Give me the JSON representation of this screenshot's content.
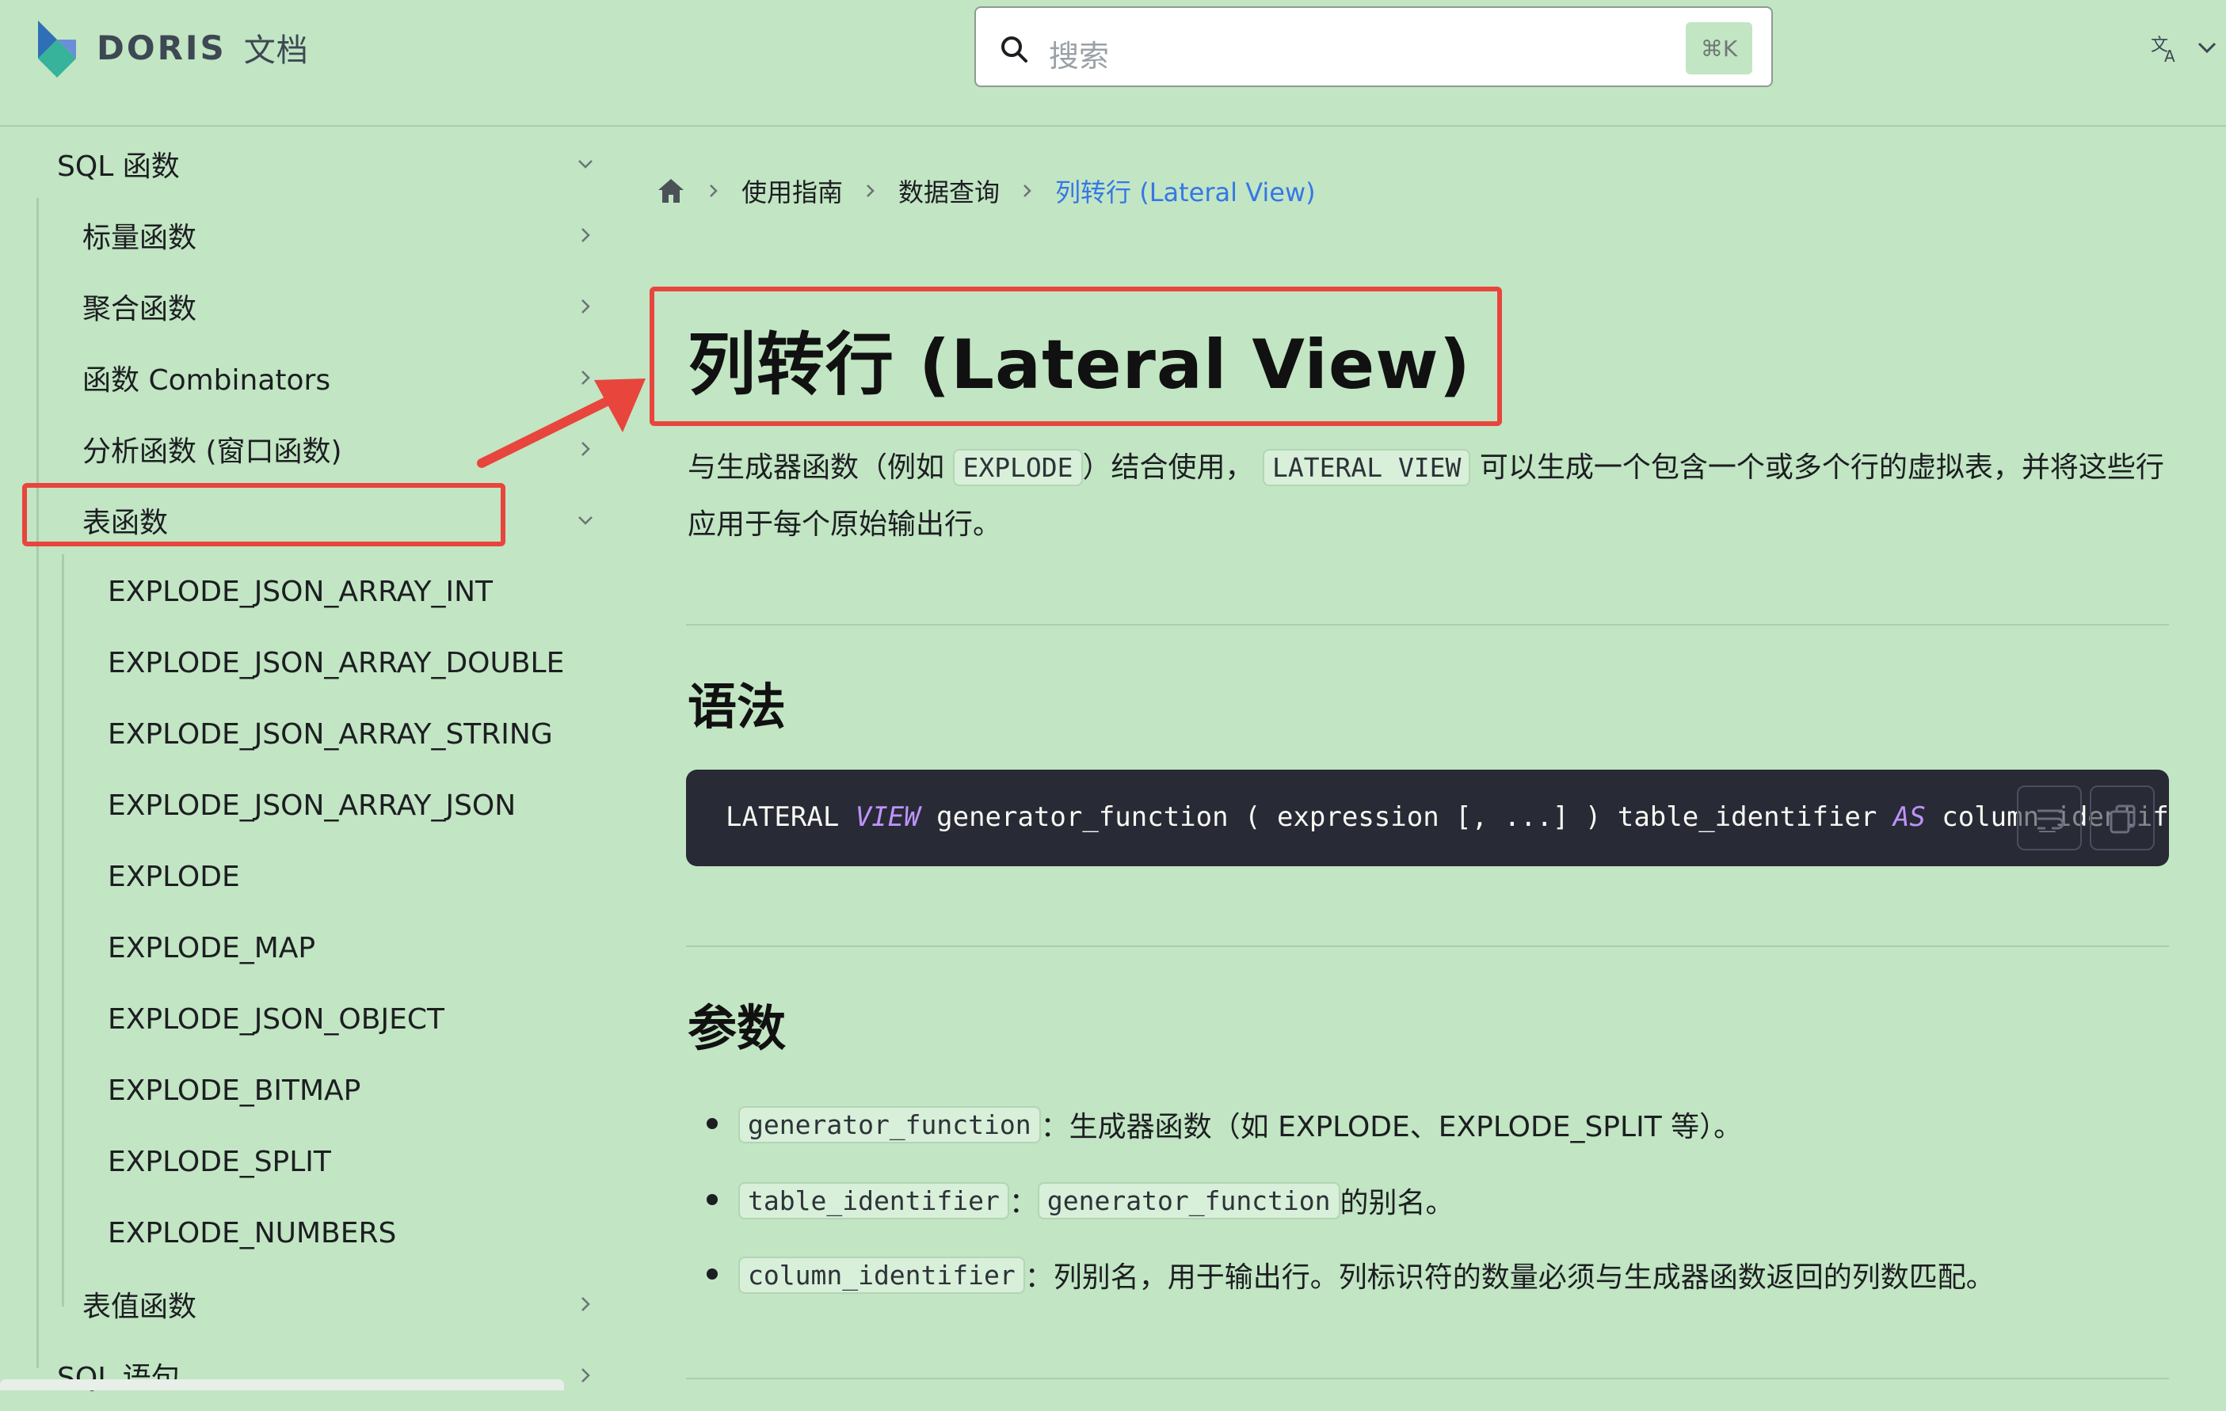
{
  "header": {
    "brand_name": "DORIS",
    "brand_suffix": "文档",
    "search": {
      "placeholder": "搜索",
      "shortcut": "⌘K"
    },
    "language_icon": "translate-icon"
  },
  "sidebar": {
    "items": [
      {
        "label": "SQL 函数",
        "chevron": "down"
      },
      {
        "label": "标量函数",
        "chevron": "right"
      },
      {
        "label": "聚合函数",
        "chevron": "right"
      },
      {
        "label": "函数 Combinators",
        "chevron": "right"
      },
      {
        "label": "分析函数 (窗口函数)",
        "chevron": "right"
      },
      {
        "label": "表函数",
        "chevron": "down"
      },
      {
        "label": "EXPLODE_JSON_ARRAY_INT"
      },
      {
        "label": "EXPLODE_JSON_ARRAY_DOUBLE"
      },
      {
        "label": "EXPLODE_JSON_ARRAY_STRING"
      },
      {
        "label": "EXPLODE_JSON_ARRAY_JSON"
      },
      {
        "label": "EXPLODE"
      },
      {
        "label": "EXPLODE_MAP"
      },
      {
        "label": "EXPLODE_JSON_OBJECT"
      },
      {
        "label": "EXPLODE_BITMAP"
      },
      {
        "label": "EXPLODE_SPLIT"
      },
      {
        "label": "EXPLODE_NUMBERS"
      },
      {
        "label": "表值函数",
        "chevron": "right"
      },
      {
        "label": "SQL 语句",
        "chevron": "right"
      }
    ]
  },
  "breadcrumb": {
    "items": [
      "使用指南",
      "数据查询",
      "列转行 (Lateral View)"
    ]
  },
  "article": {
    "title": "列转行 (Lateral View)",
    "intro": {
      "p1": "与生成器函数（例如 ",
      "code1": "EXPLODE",
      "p2": "）结合使用，",
      "code2": "LATERAL VIEW",
      "p3": " 可以生成一个包含一个或多个行的虚拟表，并将这些行应用于每个原始输出行。"
    },
    "syntax_heading": "语法",
    "code": {
      "t1": "LATERAL ",
      "k1": "VIEW",
      "t2": " generator_function ( expression [, ...] ) table_identifier ",
      "k2": "AS",
      "t3": " column_identifier"
    },
    "params_heading": "参数",
    "params": [
      {
        "code": "generator_function",
        "text": "：生成器函数（如 EXPLODE、EXPLODE_SPLIT 等）。"
      },
      {
        "code": "table_identifier",
        "sep": "：",
        "code2": "generator_function",
        "text": " 的别名。"
      },
      {
        "code": "column_identifier",
        "text": "：列别名，用于输出行。列标识符的数量必须与生成器函数返回的列数匹配。"
      }
    ]
  },
  "colors": {
    "background": "#c2e5c4",
    "link_active": "#3578e5",
    "annotation": "#e8453c",
    "code_bg": "#282a36",
    "code_keyword": "#bd93f9"
  }
}
